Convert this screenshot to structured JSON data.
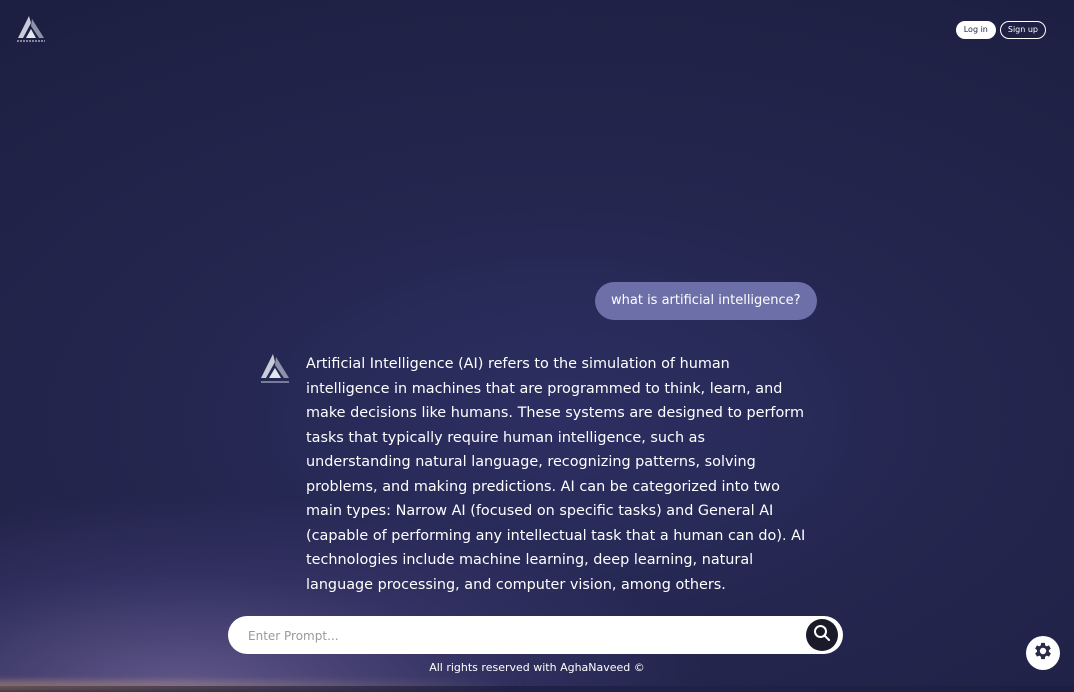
{
  "header": {
    "logo_icon": "triangle-logo-icon",
    "login_label": "Log in",
    "signup_label": "Sign up"
  },
  "chat": {
    "user_message": "what is artificial intelligence?",
    "bot_avatar_icon": "triangle-logo-icon",
    "bot_response": "Artificial Intelligence (AI) refers to the simulation of human intelligence in machines that are programmed to think, learn, and make decisions like humans. These systems are designed to perform tasks that typically require human intelligence, such as understanding natural language, recognizing patterns, solving problems, and making predictions. AI can be categorized into two main types: Narrow AI (focused on specific tasks) and General AI (capable of performing any intellectual task that a human can do). AI technologies include machine learning, deep learning, natural language processing, and computer vision, among others."
  },
  "prompt": {
    "placeholder": "Enter Prompt...",
    "value": "",
    "submit_icon": "search-icon"
  },
  "footer": {
    "text": "All rights reserved with AghaNaveed ©"
  },
  "settings": {
    "icon": "gear-icon"
  },
  "colors": {
    "background": "#24264f",
    "user_bubble": "#6d6fa8",
    "text": "#ffffff",
    "search_button": "#1a1a2a"
  }
}
